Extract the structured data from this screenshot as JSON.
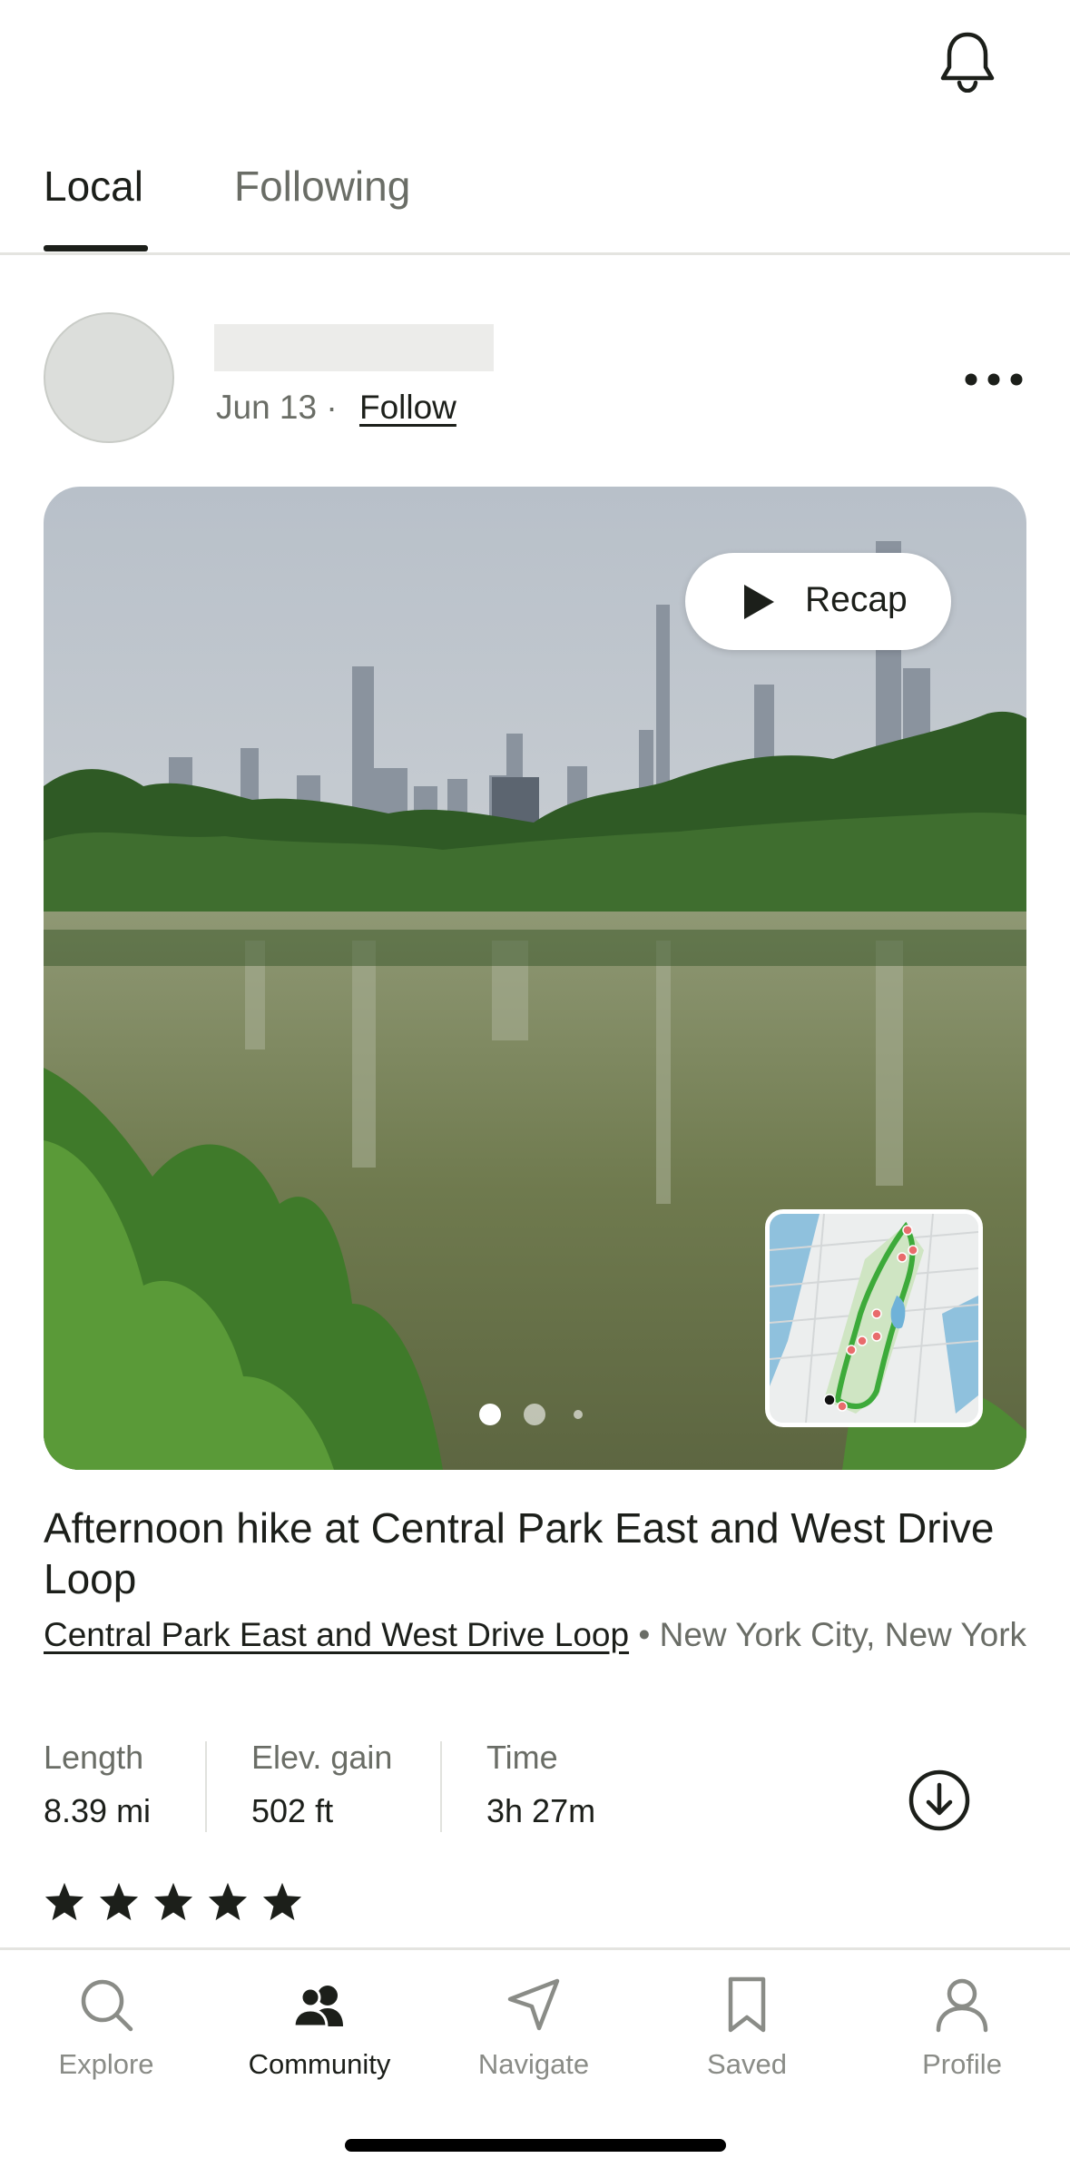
{
  "header": {
    "bell_icon": "bell-icon"
  },
  "tabs": [
    {
      "label": "Local",
      "active": true
    },
    {
      "label": "Following",
      "active": false
    }
  ],
  "post": {
    "date": "Jun 13",
    "separator": "·",
    "follow_label": "Follow",
    "more_icon": "more-horizontal-icon",
    "recap_label": "Recap",
    "photo_pages": {
      "current": 1,
      "total": 3
    },
    "title": "Afternoon hike at Central Park East and West Drive Loop",
    "trail_name": "Central Park East and West Drive Loop",
    "location_sep": "•",
    "location": "New York City, New York",
    "stats": [
      {
        "label": "Length",
        "value": "8.39 mi"
      },
      {
        "label": "Elev. gain",
        "value": "502 ft"
      },
      {
        "label": "Time",
        "value": "3h 27m"
      }
    ],
    "rating": 5,
    "rating_max": 5,
    "download_icon": "download-icon"
  },
  "bottom_nav": [
    {
      "label": "Explore",
      "icon": "search-icon",
      "active": false
    },
    {
      "label": "Community",
      "icon": "community-icon",
      "active": true
    },
    {
      "label": "Navigate",
      "icon": "navigate-icon",
      "active": false
    },
    {
      "label": "Saved",
      "icon": "bookmark-icon",
      "active": false
    },
    {
      "label": "Profile",
      "icon": "profile-icon",
      "active": false
    }
  ],
  "colors": {
    "accent": "#1c1f1a",
    "muted": "#6a6d66",
    "route": "#3daa3a"
  }
}
